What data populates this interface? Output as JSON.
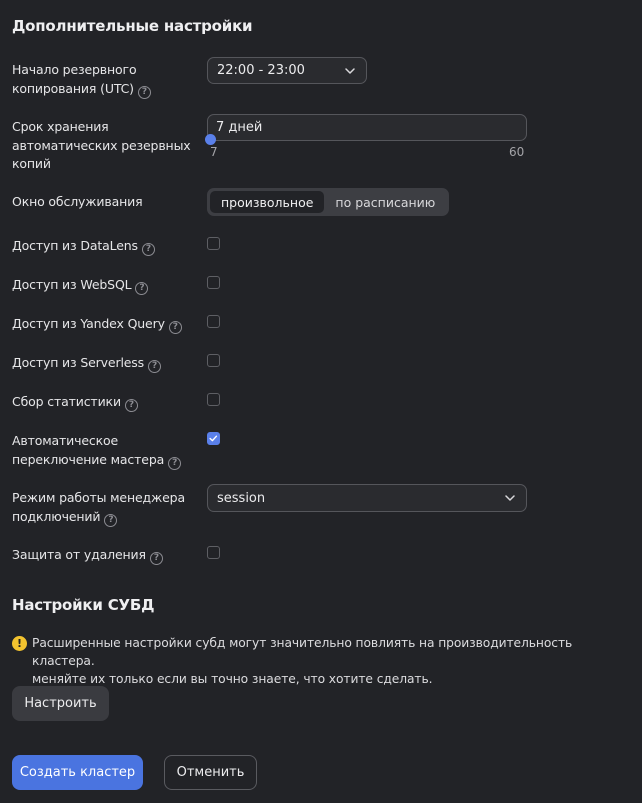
{
  "section_advanced": {
    "title": "Дополнительные настройки"
  },
  "backup_start": {
    "label": "Начало резервного копирования (UTC)",
    "value": "22:00 - 23:00"
  },
  "retention": {
    "label": "Срок хранения автоматических резервных копий",
    "value": "7 дней",
    "min": "7",
    "max": "60",
    "level": 0.0
  },
  "maintenance": {
    "label": "Окно обслуживания",
    "options": [
      "произвольное",
      "по расписанию"
    ],
    "selected": "произвольное"
  },
  "toggles": [
    {
      "label": "Доступ из DataLens",
      "checked": false
    },
    {
      "label": "Доступ из WebSQL",
      "checked": false
    },
    {
      "label": "Доступ из Yandex Query",
      "checked": false
    },
    {
      "label": "Доступ из Serverless",
      "checked": false
    },
    {
      "label": "Сбор статистики",
      "checked": false
    },
    {
      "label": "Автоматическое переключение мастера",
      "checked": true
    }
  ],
  "pooler": {
    "label": "Режим работы менеджера подключений",
    "value": "session"
  },
  "deletion_protection": {
    "label": "Защита от удаления",
    "checked": false
  },
  "section_dbms": {
    "title": "Настройки СУБД"
  },
  "alert": {
    "line1": "Расширенные настройки субд могут значительно повлиять на производительность кластера.",
    "line2": "меняйте их только если вы точно знаете, что хотите сделать."
  },
  "buttons": {
    "configure": "Настроить",
    "create": "Создать кластер",
    "cancel": "Отменить"
  },
  "icons": {
    "help": "question-circle-icon",
    "chevron": "chevron-down-icon",
    "check": "check-icon",
    "alert": "exclamation-circle-icon"
  },
  "colors": {
    "accent": "#5a80ea",
    "warning": "#f3c32f",
    "background": "#222327"
  }
}
